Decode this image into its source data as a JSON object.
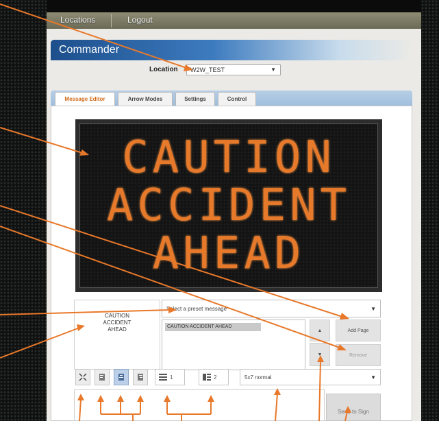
{
  "nav": {
    "locations": "Locations",
    "logout": "Logout"
  },
  "header": {
    "title": "Commander"
  },
  "location": {
    "label": "Location",
    "value": "W2W_TEST"
  },
  "tabs": [
    "Message Editor",
    "Arrow Modes",
    "Settings",
    "Control"
  ],
  "sign": {
    "lines": [
      "CAUTION",
      "ACCIDENT",
      "AHEAD"
    ],
    "led_color": "#e7792b"
  },
  "preview": {
    "lines": [
      "CAUTION",
      "ACCIDENT",
      "AHEAD"
    ]
  },
  "preset": {
    "placeholder": "Select a preset message"
  },
  "message_list": {
    "items": [
      "CAUTION ACCIDENT AHEAD"
    ]
  },
  "buttons": {
    "add_page": "Add Page",
    "remove": "Remove",
    "send": "Send to Sign",
    "up": "▲",
    "down": "▼"
  },
  "toolbar": {
    "line_spacing": "1",
    "page_count": "2",
    "font": "5x7 normal"
  },
  "colors": {
    "accent": "#e8782a",
    "header_blue": "#2d63a6",
    "active_tab": "#d06a18"
  },
  "icons": [
    "auto-fit-icon",
    "align-left-icon",
    "align-center-icon",
    "align-right-icon",
    "line-spacing-icon",
    "page-count-icon"
  ]
}
